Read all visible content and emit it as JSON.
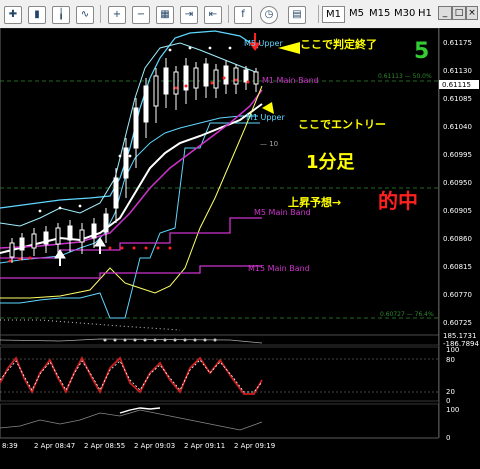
{
  "toolbar": {
    "timeframes": [
      "M1",
      "M5",
      "M15",
      "M30",
      "H1"
    ],
    "active_timeframe": "M1"
  },
  "main_chart": {
    "price_labels": [
      "0.61175",
      "0.61130",
      "0.61085",
      "0.61040",
      "0.60995",
      "0.60950",
      "0.60905",
      "0.60860",
      "0.60815",
      "0.60770",
      "0.60725"
    ],
    "current_price": "0.61115",
    "level_top": "0.61113 — 50.0%",
    "level_bottom": "0.60727 — 76.4%",
    "level_mid": "— 10",
    "indicators": {
      "m5_upper": "M5 Upper",
      "m1_main": "M1 Main Band",
      "m1_upper": "M1 Upper",
      "m5_main": "M5 Main Band",
      "m15_main": "M15 Main Band"
    },
    "symbol_label": "5"
  },
  "annotations": {
    "judgement": "ここで判定終了",
    "entry": "ここでエントリー",
    "timeframe": "1分足",
    "result_prefix": "上昇予想→",
    "result_hit": "的中"
  },
  "sub1": {
    "labels": [
      "185.1731",
      "-186.7894"
    ]
  },
  "sub2": {
    "labels": [
      "100",
      "80",
      "20",
      "0"
    ]
  },
  "sub3": {
    "labels": [
      "100",
      "0"
    ]
  },
  "time_axis": [
    "8:39",
    "2 Apr 08:47",
    "2 Apr 08:55",
    "2 Apr 09:03",
    "2 Apr 09:11",
    "2 Apr 09:19"
  ],
  "colors": {
    "background": "#000000",
    "annotation_yellow": "#ffff00",
    "annotation_red": "#ff2020",
    "band_cyan": "#5fd7ff",
    "band_magenta": "#cc33cc"
  }
}
